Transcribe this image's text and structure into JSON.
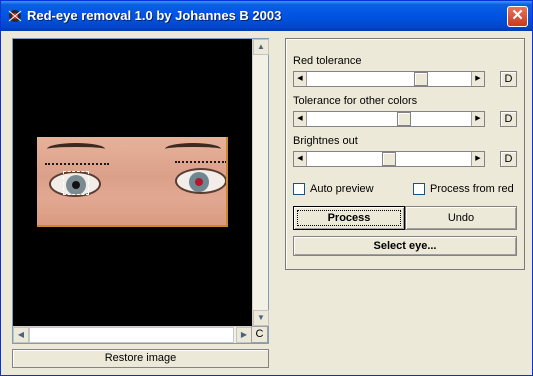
{
  "window": {
    "title": "Red-eye removal 1.0 by Johannes B 2003",
    "close_glyph": "✕",
    "title_bar_color": "#0054e3"
  },
  "image_view": {
    "background_color": "#000000",
    "corner_button_label": "C",
    "restore_label": "Restore image"
  },
  "controls": {
    "sliders": [
      {
        "label": "Red tolerance",
        "value_fraction": 0.71,
        "reset_label": "D"
      },
      {
        "label": "Tolerance for other colors",
        "value_fraction": 0.6,
        "reset_label": "D"
      },
      {
        "label": "Brightnes out",
        "value_fraction": 0.5,
        "reset_label": "D"
      }
    ],
    "checkboxes": [
      {
        "label": "Auto preview",
        "checked": false
      },
      {
        "label": "Process from red",
        "checked": false
      }
    ],
    "process_label": "Process",
    "undo_label": "Undo",
    "select_eye_label": "Select eye..."
  },
  "icons": {
    "app": "red-eye-app-icon",
    "left_arrow": "◀",
    "right_arrow": "▶",
    "up_arrow": "▲",
    "down_arrow": "▼"
  }
}
